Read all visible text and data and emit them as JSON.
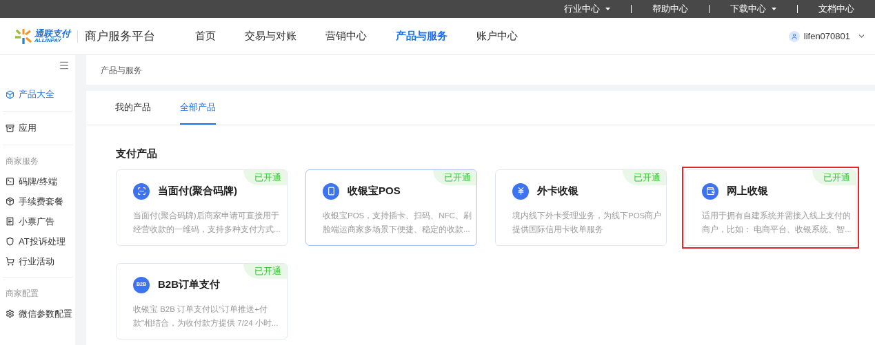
{
  "top_links": [
    {
      "label": "行业中心",
      "dropdown": true
    },
    {
      "label": "帮助中心",
      "dropdown": false
    },
    {
      "label": "下载中心",
      "dropdown": true
    },
    {
      "label": "文档中心",
      "dropdown": false
    }
  ],
  "header": {
    "logo_cn": "通联支付",
    "logo_en": "ALLINPAY",
    "platform": "商户服务平台",
    "user": "lifen070801"
  },
  "nav": [
    {
      "label": "首页",
      "selected": false
    },
    {
      "label": "交易与对账",
      "selected": false
    },
    {
      "label": "营销中心",
      "selected": false
    },
    {
      "label": "产品与服务",
      "selected": true
    },
    {
      "label": "账户中心",
      "selected": false
    }
  ],
  "sidebar": {
    "groups": [
      {
        "items": [
          {
            "label": "产品大全",
            "kind": "box",
            "selected": true
          }
        ]
      },
      {
        "items": [
          {
            "label": "应用",
            "kind": "archive",
            "selected": false
          }
        ]
      },
      {
        "title": "商家服务",
        "items": [
          {
            "label": "码牌/终端",
            "kind": "terminal",
            "selected": false
          },
          {
            "label": "手续费套餐",
            "kind": "package",
            "selected": false
          },
          {
            "label": "小票广告",
            "kind": "receipt",
            "selected": false
          },
          {
            "label": "AT投诉处理",
            "kind": "shield",
            "selected": false
          },
          {
            "label": "行业活动",
            "kind": "cart",
            "selected": false
          }
        ]
      },
      {
        "title": "商家配置",
        "items": [
          {
            "label": "微信参数配置",
            "kind": "settings",
            "selected": false
          }
        ]
      }
    ]
  },
  "breadcrumb": "产品与服务",
  "tabs": [
    {
      "label": "我的产品",
      "selected": false
    },
    {
      "label": "全部产品",
      "selected": true
    }
  ],
  "section_title": "支付产品",
  "products": [
    {
      "kind": "scan",
      "title": "当面付(聚合码牌)",
      "description": [
        "当面付(聚合码牌)后商家申请可直接用于",
        "经营收款的一维码，支持多种支付方式..."
      ],
      "badge": "已开通",
      "highlighted": false,
      "annotated": false
    },
    {
      "kind": "pos",
      "title": "收银宝POS",
      "description": [
        "收银宝POS，支持插卡、扫码、NFC、刷",
        "脸端运商家多场景下便捷、稳定的收款..."
      ],
      "badge": "已开通",
      "highlighted": true,
      "annotated": false
    },
    {
      "kind": "yen",
      "title": "外卡收银",
      "description": [
        "境内线下外卡受理业务，为线下POS商户",
        "提供国际信用卡收单服务"
      ],
      "badge": "已开通",
      "highlighted": false,
      "annotated": false
    },
    {
      "kind": "wallet",
      "title": "网上收银",
      "description": [
        "适用于拥有自建系统并需接入线上支付的",
        "商户，比如： 电商平台、收银系统、智..."
      ],
      "badge": "已开通",
      "highlighted": false,
      "annotated": true
    },
    {
      "kind": "b2b",
      "icon_label": "B2B",
      "title": "B2B订单支付",
      "description": [
        "收银宝 B2B 订单支付以\"订单推送+付",
        "款\"相结合，为收付款方提供 7/24 小时..."
      ],
      "badge": "已开通",
      "highlighted": false,
      "annotated": false
    }
  ]
}
